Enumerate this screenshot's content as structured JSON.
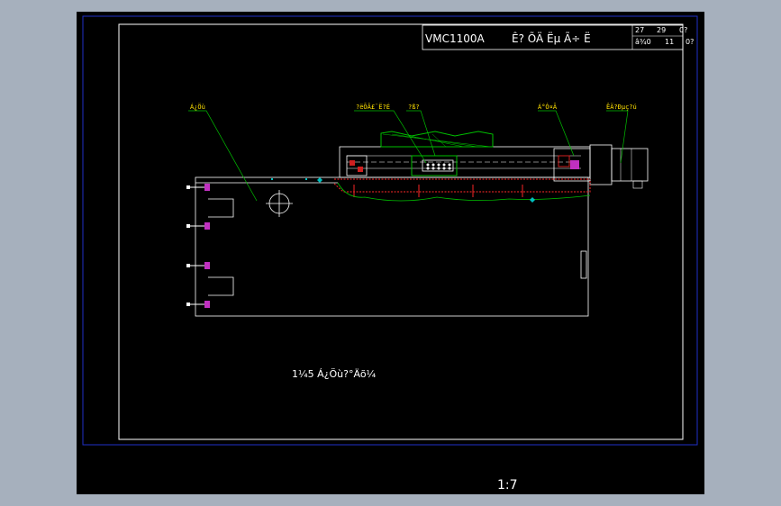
{
  "title_block": {
    "model": "VMC1100A",
    "chars": "Ê?  ÕÄ  Ëµ  Ã÷  Ë",
    "row1": [
      "27",
      "29",
      "0?"
    ],
    "row2": [
      "â¾0",
      "11",
      "0?"
    ]
  },
  "callouts": {
    "left": "Á¿Öù",
    "mid1": "?ëÕÂ£¨Ë?É",
    "mid2": "?ß?",
    "right1": "Á°Ó¤Ã",
    "right2": "ÊÄ?Ðµç?ú"
  },
  "caption": "1¼5   Á¿Öù?°Äõ¼",
  "scale": "1:7",
  "colors": {
    "background": "#a6b0bd",
    "viewport": "#000000",
    "border_blue": "#2030c8",
    "callout_text": "#ffe000",
    "leader": "#00c000"
  }
}
